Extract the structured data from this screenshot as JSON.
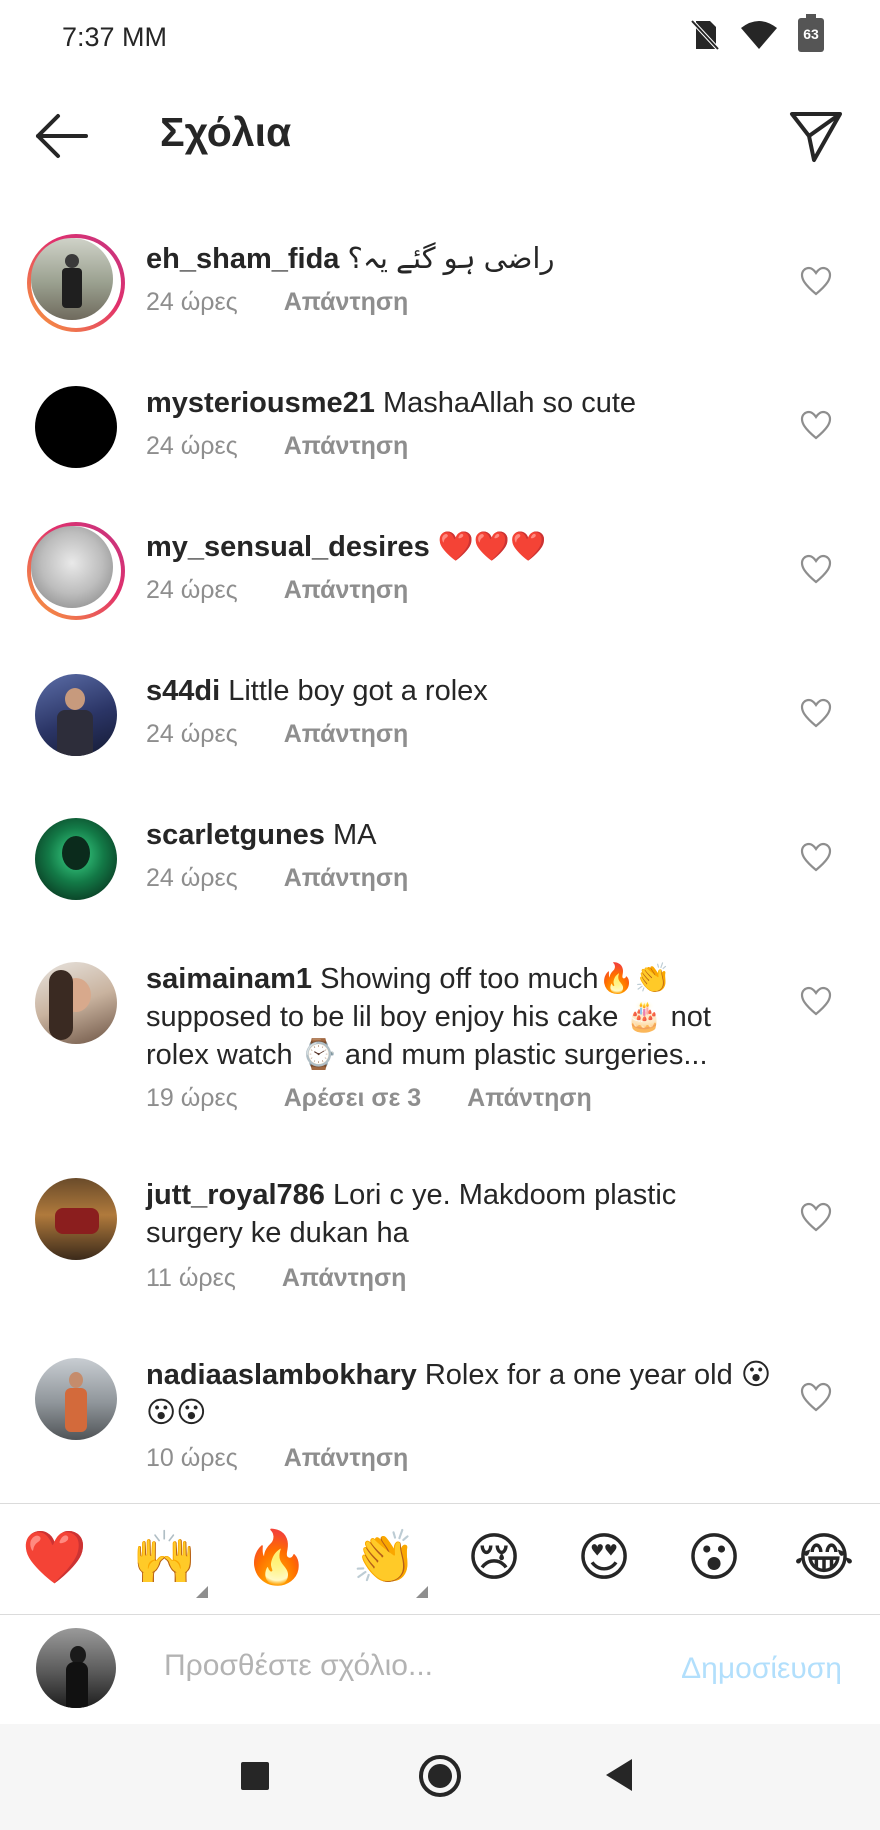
{
  "status_bar": {
    "time": "7:37 MM",
    "battery": "63",
    "icons": [
      "no-sim-icon",
      "wifi-icon",
      "battery-icon"
    ]
  },
  "header": {
    "title": "Σχόλια",
    "back_icon": "arrow-left-icon",
    "share_icon": "paper-plane-icon"
  },
  "comments": [
    {
      "username": "eh_sham_fida",
      "text": "راضی ہو گئے یہ؟",
      "time": "24 ώρες",
      "likes": "",
      "reply": "Απάντηση"
    },
    {
      "username": "mysteriousme21",
      "text": "MashaAllah so cute",
      "time": "24 ώρες",
      "likes": "",
      "reply": "Απάντηση"
    },
    {
      "username": "my_sensual_desires",
      "text": "❤️❤️❤️",
      "time": "24 ώρες",
      "likes": "",
      "reply": "Απάντηση"
    },
    {
      "username": "s44di",
      "text": "Little boy got a rolex",
      "time": "24 ώρες",
      "likes": "",
      "reply": "Απάντηση"
    },
    {
      "username": "scarletgunes",
      "text": "MA",
      "time": "24 ώρες",
      "likes": "",
      "reply": "Απάντηση"
    },
    {
      "username": "saimainam1",
      "text": "Showing off too much🔥👏 supposed to be lil boy enjoy his cake 🎂 not rolex watch ⌚ and mum plastic surgeries...",
      "time": "19 ώρες",
      "likes": "Αρέσει σε 3",
      "reply": "Απάντηση"
    },
    {
      "username": "jutt_royal786",
      "text": "Lori c ye. Makdoom plastic surgery ke dukan ha",
      "time": "11 ώρες",
      "likes": "",
      "reply": "Απάντηση"
    },
    {
      "username": "nadiaaslambokhary",
      "text": "Rolex for a one year old 😮😮😮",
      "time": "10 ώρες",
      "likes": "",
      "reply": "Απάντηση"
    }
  ],
  "emoji_bar": [
    "❤️",
    "🙌",
    "🔥",
    "👏",
    "😢",
    "😍",
    "😮",
    "😂"
  ],
  "composer": {
    "placeholder": "Προσθέστε σχόλιο...",
    "post_label": "Δημοσίευση"
  },
  "nav_bar": [
    "recents-icon",
    "home-icon",
    "back-icon"
  ]
}
